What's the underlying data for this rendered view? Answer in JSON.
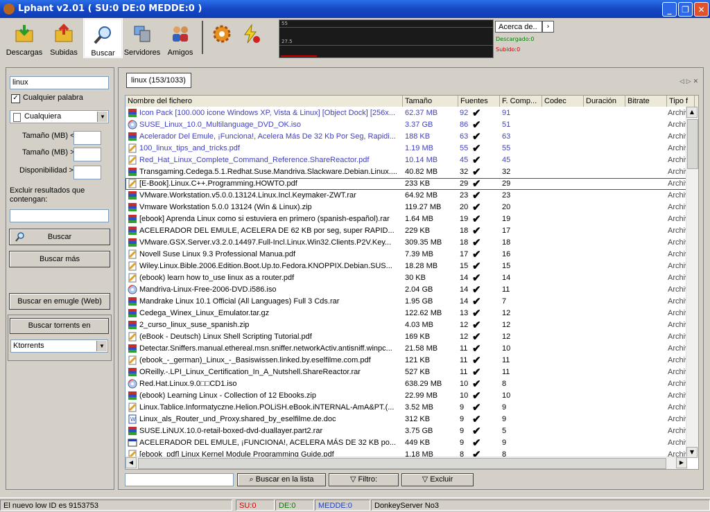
{
  "window": {
    "title": "Lphant v2.01 ( SU:0 DE:0 MEDDE:0 )"
  },
  "toolbar": {
    "buttons": [
      {
        "label": "Descargas"
      },
      {
        "label": "Subidas"
      },
      {
        "label": "Buscar"
      },
      {
        "label": "Servidores"
      },
      {
        "label": "Amigos"
      }
    ],
    "graph_ticks": [
      "55",
      "27.5"
    ],
    "acerca_label": "Acerca de..",
    "descargado": "Descargado:0",
    "subido": "Subido:0"
  },
  "search": {
    "query": "linux",
    "any_word_label": "Cualquier palabra",
    "type_value": "Cualquiera",
    "size_min_label": "Tamaño (MB) <",
    "size_max_label": "Tamaño (MB) >",
    "availability_label": "Disponibilidad >",
    "exclude_label": "Excluir resultados que contengan:",
    "buscar_label": "Buscar",
    "buscar_mas_label": "Buscar más",
    "emugle_label": "Buscar en emugle (Web)",
    "torrents_label": "Buscar torrents en",
    "torrent_site": "Ktorrents"
  },
  "results": {
    "tab_label": "linux (153/1033)",
    "columns": [
      "Nombre del fichero",
      "Tamaño",
      "Fuentes",
      "F. Comp...",
      "Codec",
      "Duración",
      "Bitrate",
      "Tipo f"
    ],
    "rows": [
      {
        "name": "Icon Pack [100.000 icone Windows XP, Vista & Linux] [Object Dock] [256x...",
        "size": "62.37 MB",
        "src": "92",
        "comp": "91",
        "type": "Archiv",
        "icon": "rar",
        "color": "#4040c0"
      },
      {
        "name": "SUSE_Linux_10.0_Multilanguage_DVD_OK.iso",
        "size": "3.37 GB",
        "src": "86",
        "comp": "51",
        "type": "Archiv",
        "icon": "iso",
        "color": "#4040c0"
      },
      {
        "name": "Acelerador Del Emule, ¡Funciona!, Acelera Más De 32 Kb Por Seg, Rapidi...",
        "size": "188 KB",
        "src": "63",
        "comp": "63",
        "type": "Archiv",
        "icon": "rar",
        "color": "#4040c0"
      },
      {
        "name": "100_linux_tips_and_tricks.pdf",
        "size": "1.19 MB",
        "src": "55",
        "comp": "55",
        "type": "Archiv",
        "icon": "pdf",
        "color": "#4040c0"
      },
      {
        "name": "Red_Hat_Linux_Complete_Command_Reference.ShareReactor.pdf",
        "size": "10.14 MB",
        "src": "45",
        "comp": "45",
        "type": "Archiv",
        "icon": "pdf",
        "color": "#4040c0"
      },
      {
        "name": "Transgaming.Cedega.5.1.Redhat.Suse.Mandriva.Slackware.Debian.Linux....",
        "size": "40.82 MB",
        "src": "32",
        "comp": "32",
        "type": "Archiv",
        "icon": "rar",
        "color": "#000000"
      },
      {
        "name": "[E-Book].Linux.C++.Programming.HOWTO.pdf",
        "size": "233 KB",
        "src": "29",
        "comp": "29",
        "type": "Archiv",
        "icon": "pdf",
        "color": "#000000"
      },
      {
        "name": "VMware.Workstation.v5.0.0.13124.Linux.Incl.Keymaker-ZWT.rar",
        "size": "64.92 MB",
        "src": "23",
        "comp": "23",
        "type": "Archiv",
        "icon": "rar",
        "color": "#000000"
      },
      {
        "name": "Vmware Workstation 5.0.0 13124 (Win & Linux).zip",
        "size": "119.27 MB",
        "src": "20",
        "comp": "20",
        "type": "Archiv",
        "icon": "rar",
        "color": "#000000"
      },
      {
        "name": "[ebook] Aprenda Linux como si estuviera en primero (spanish-español).rar",
        "size": "1.64 MB",
        "src": "19",
        "comp": "19",
        "type": "Archiv",
        "icon": "rar",
        "color": "#000000"
      },
      {
        "name": "ACELERADOR DEL EMULE, ACELERA DE 62 KB por seg, super RAPID...",
        "size": "229 KB",
        "src": "18",
        "comp": "17",
        "type": "Archiv",
        "icon": "rar",
        "color": "#000000"
      },
      {
        "name": "VMware.GSX.Server.v3.2.0.14497.Full-Incl.Linux.Win32.Clients.P2V.Key...",
        "size": "309.35 MB",
        "src": "18",
        "comp": "18",
        "type": "Archiv",
        "icon": "rar",
        "color": "#000000"
      },
      {
        "name": "Novell Suse Linux 9.3 Professional Manua.pdf",
        "size": "7.39 MB",
        "src": "17",
        "comp": "16",
        "type": "Archiv",
        "icon": "pdf",
        "color": "#000000"
      },
      {
        "name": "Wiley.Linux.Bible.2006.Edition.Boot.Up.to.Fedora.KNOPPIX.Debian.SUS...",
        "size": "18.28 MB",
        "src": "15",
        "comp": "15",
        "type": "Archiv",
        "icon": "pdf",
        "color": "#000000"
      },
      {
        "name": "(ebook) learn how to_use linux as a router.pdf",
        "size": "30 KB",
        "src": "14",
        "comp": "14",
        "type": "Archiv",
        "icon": "pdf",
        "color": "#000000"
      },
      {
        "name": "Mandriva-Linux-Free-2006-DVD.i586.iso",
        "size": "2.04 GB",
        "src": "14",
        "comp": "11",
        "type": "Archiv",
        "icon": "iso",
        "color": "#000000"
      },
      {
        "name": "Mandrake Linux 10.1 Official (All Languages) Full 3 Cds.rar",
        "size": "1.95 GB",
        "src": "14",
        "comp": "7",
        "type": "Archiv",
        "icon": "rar",
        "color": "#000000"
      },
      {
        "name": "Cedega_Winex_Linux_Emulator.tar.gz",
        "size": "122.62 MB",
        "src": "13",
        "comp": "12",
        "type": "Archiv",
        "icon": "rar",
        "color": "#000000"
      },
      {
        "name": "2_curso_linux_suse_spanish.zip",
        "size": "4.03 MB",
        "src": "12",
        "comp": "12",
        "type": "Archiv",
        "icon": "rar",
        "color": "#000000"
      },
      {
        "name": "(eBook - Deutsch) Linux Shell Scripting Tutorial.pdf",
        "size": "169 KB",
        "src": "12",
        "comp": "12",
        "type": "Archiv",
        "icon": "pdf",
        "color": "#000000"
      },
      {
        "name": "Detectar.Sniffers.manual.ethereal.msn.sniffer.networkActiv.antisniff.winpc...",
        "size": "21.58 MB",
        "src": "11",
        "comp": "10",
        "type": "Archiv",
        "icon": "rar",
        "color": "#000000"
      },
      {
        "name": "(ebook_-_german)_Linux_-_Basiswissen.linked.by.eselfilme.com.pdf",
        "size": "121 KB",
        "src": "11",
        "comp": "11",
        "type": "Archiv",
        "icon": "pdf",
        "color": "#000000"
      },
      {
        "name": "OReilly.-.LPI_Linux_Certification_In_A_Nutshell.ShareReactor.rar",
        "size": "527 KB",
        "src": "11",
        "comp": "11",
        "type": "Archiv",
        "icon": "rar",
        "color": "#000000"
      },
      {
        "name": "Red.Hat.Linux.9.0□□CD1.iso",
        "size": "638.29 MB",
        "src": "10",
        "comp": "8",
        "type": "Archiv",
        "icon": "iso",
        "color": "#000000"
      },
      {
        "name": "(ebook) Learning Linux - Collection of 12 Ebooks.zip",
        "size": "22.99 MB",
        "src": "10",
        "comp": "10",
        "type": "Archiv",
        "icon": "rar",
        "color": "#000000"
      },
      {
        "name": "Linux.Tablice.Informatyczne.Helion.POLiSH.eBook.iNTERNAL-AmA&PT.(...",
        "size": "3.52 MB",
        "src": "9",
        "comp": "9",
        "type": "Archiv",
        "icon": "pdf",
        "color": "#000000"
      },
      {
        "name": "Linux_als_Router_und_Proxy.shared_by_eselfilme.de.doc",
        "size": "312 KB",
        "src": "9",
        "comp": "9",
        "type": "Archiv",
        "icon": "doc",
        "color": "#000000"
      },
      {
        "name": "SUSE.LiNUX.10.0-retail-boxed-dvd-duallayer.part2.rar",
        "size": "3.75 GB",
        "src": "9",
        "comp": "5",
        "type": "Archiv",
        "icon": "rar",
        "color": "#000000"
      },
      {
        "name": "ACELERADOR DEL EMULE, ¡FUNCIONA!, ACELERA MÁS DE 32 KB po...",
        "size": "449 KB",
        "src": "9",
        "comp": "9",
        "type": "Archiv",
        "icon": "exe",
        "color": "#000000"
      },
      {
        "name": "[ebook_pdf] Linux Kernel Module Programming Guide.pdf",
        "size": "1.18 MB",
        "src": "8",
        "comp": "8",
        "type": "Archiv",
        "icon": "pdf",
        "color": "#000000"
      }
    ],
    "find_in_list_label": "Buscar en la lista",
    "filter_label": "Filtro:",
    "exclude_label": "Excluir"
  },
  "statusbar": {
    "message": "El nuevo low ID es 9153753",
    "su": "SU:0",
    "de": "DE:0",
    "medde": "MEDDE:0",
    "server": "DonkeyServer No3"
  },
  "colors": {
    "su": "#d00000",
    "de": "#008000",
    "medde": "#2040c0"
  }
}
